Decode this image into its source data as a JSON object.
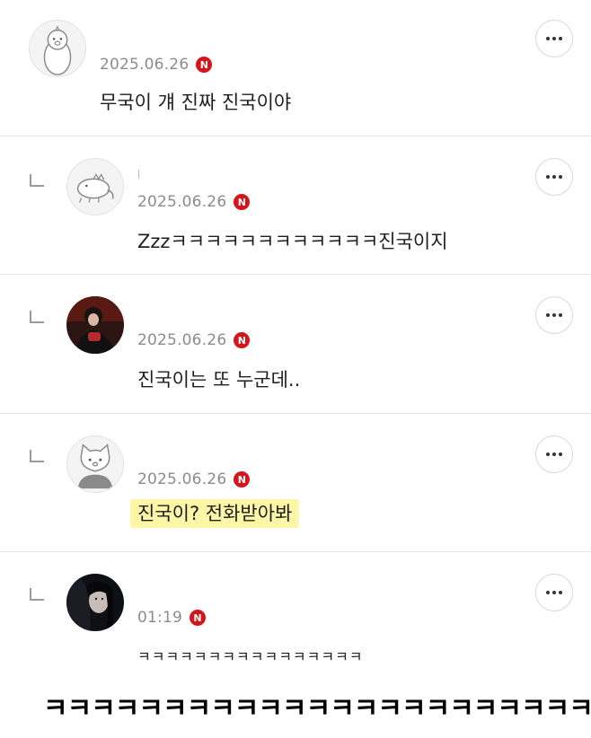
{
  "comments": [
    {
      "date": "2025.06.26",
      "badge": "N",
      "text": "무국이 걔 진짜 진국이야",
      "avatar": "duck-mascot-avatar",
      "is_reply": false
    },
    {
      "date": "2025.06.26",
      "badge": "N",
      "text": "Zzzㅋㅋㅋㅋㅋㅋㅋㅋㅋㅋㅋㅋ진국이지",
      "avatar": "crocodile-mascot-avatar",
      "is_reply": true
    },
    {
      "date": "2025.06.26",
      "badge": "N",
      "text": "진국이는 또 누군데..",
      "avatar": "photo-avatar-person",
      "is_reply": true
    },
    {
      "date": "2025.06.26",
      "badge": "N",
      "text": "진국이? 전화받아봐",
      "avatar": "cat-mascot-avatar",
      "is_reply": true,
      "highlighted": true
    },
    {
      "date": "01:19",
      "badge": "N",
      "text": "ㅋㅋㅋㅋㅋㅋㅋㅋㅋㅋㅋㅋㅋㅋㅋㅋ",
      "avatar": "photo-avatar-dark",
      "is_reply": true
    }
  ],
  "caption": "ㅋㅋㅋㅋㅋㅋㅋㅋㅋㅋㅋㅋㅋㅋㅋㅋㅋㅋㅋㅋㅋㅋㅋ",
  "colors": {
    "badge": "#d4161c",
    "highlight": "#fdf6a6",
    "divider": "#e6e6e6",
    "date": "#8c8c8c"
  },
  "icons": [
    "more-options-icon",
    "reply-arrow-icon",
    "new-badge-icon"
  ]
}
